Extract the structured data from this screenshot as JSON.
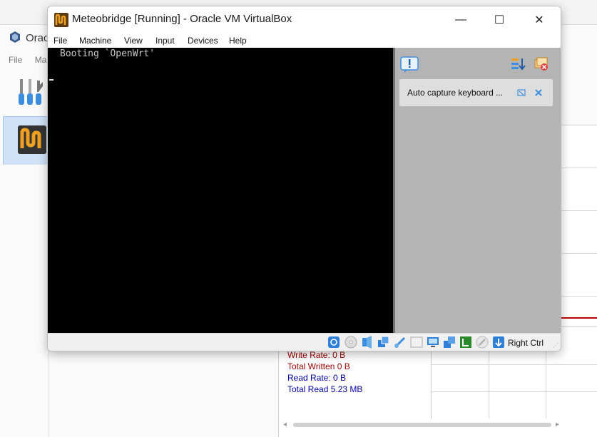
{
  "background_window": {
    "title": "Orac",
    "menu": [
      "File",
      "Ma"
    ],
    "stats": {
      "write_rate": "Write Rate: 0 B",
      "total_written": "Total Written 0 B",
      "read_rate": "Read Rate: 0 B",
      "total_read": "Total Read 5.23 MB"
    }
  },
  "vm_window": {
    "title": "Meteobridge [Running] - Oracle VM VirtualBox",
    "controls": {
      "minimize": "—",
      "maximize": "☐",
      "close": "✕"
    },
    "menu": [
      "File",
      "Machine",
      "View",
      "Input",
      "Devices",
      "Help"
    ],
    "console_text": "Booting `OpenWrt'",
    "notification": {
      "message": "Auto capture keyboard ..."
    },
    "status_icons": [
      "hard-disk-icon",
      "optical-drive-icon",
      "audio-icon",
      "network-icon",
      "usb-icon",
      "shared-folders-icon",
      "display-icon",
      "recording-icon",
      "cpu-icon",
      "mouse-integration-icon",
      "host-key-icon"
    ],
    "host_key": "Right Ctrl"
  },
  "colors": {
    "write_stats": "#9b0000",
    "read_stats": "#0000aa",
    "console_bg": "#000000",
    "notification_bg": "#b4b4b4"
  }
}
